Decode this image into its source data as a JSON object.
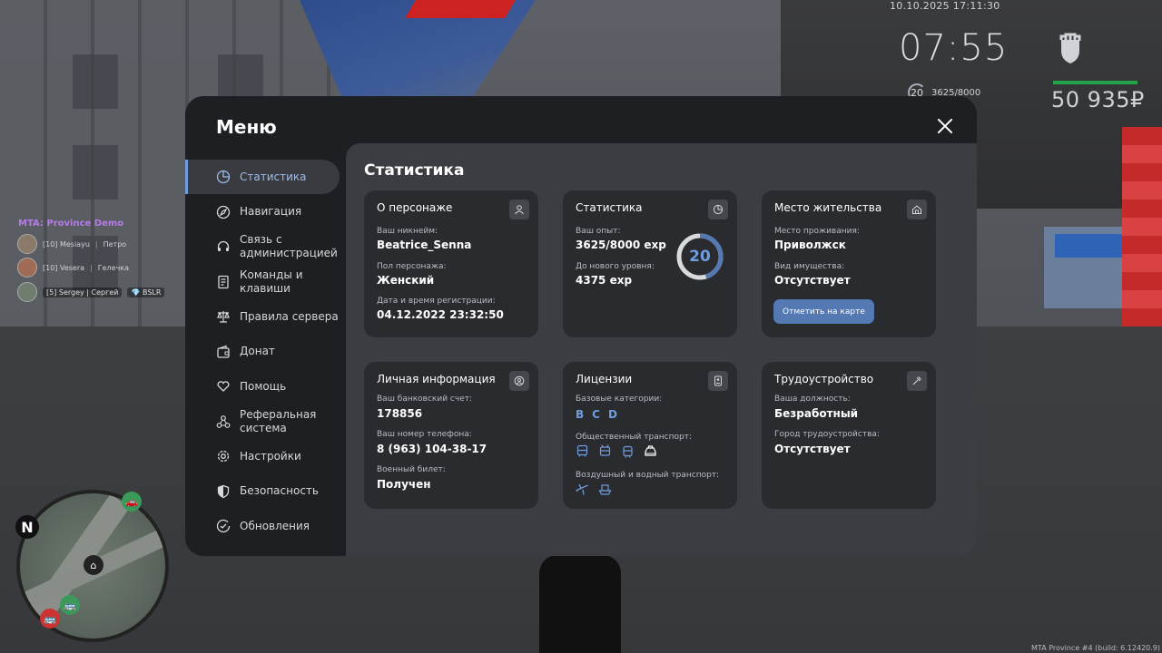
{
  "hud": {
    "datetime": "10.10.2025 17:11:30",
    "clock": "07:55",
    "level": "20",
    "exp": "3625/8000",
    "money": "50 935₽"
  },
  "server": {
    "name": "MTA: Province Demo",
    "players": [
      {
        "tag": "[10] Mesiayu",
        "name": "Петро"
      },
      {
        "tag": "[10] Vesera",
        "name": "Гелечка"
      },
      {
        "tag": "[5] Sergey",
        "name": "Сергей",
        "badge": "BSLR"
      }
    ],
    "build": "MTA Province #4 (build: 6.12420.9)"
  },
  "minimap": {
    "north": "N"
  },
  "menu": {
    "title": "Меню",
    "sidebar": [
      {
        "label": "Статистика",
        "icon": "pie-chart-icon"
      },
      {
        "label": "Навигация",
        "icon": "compass-icon"
      },
      {
        "label": "Связь с администрацией",
        "icon": "headset-icon"
      },
      {
        "label": "Команды и клавиши",
        "icon": "document-icon"
      },
      {
        "label": "Правила сервера",
        "icon": "scales-icon"
      },
      {
        "label": "Донат",
        "icon": "wallet-icon"
      },
      {
        "label": "Помощь",
        "icon": "heart-hands-icon"
      },
      {
        "label": "Реферальная система",
        "icon": "network-icon"
      },
      {
        "label": "Настройки",
        "icon": "gear-icon"
      },
      {
        "label": "Безопасность",
        "icon": "shield-icon"
      },
      {
        "label": "Обновления",
        "icon": "check-circle-icon"
      }
    ],
    "section_title": "Статистика",
    "cards": {
      "character": {
        "title": "О персонаже",
        "nick_label": "Ваш никнейм:",
        "nick": "Beatrice_Senna",
        "gender_label": "Пол персонажа:",
        "gender": "Женский",
        "reg_label": "Дата и время регистрации:",
        "reg": "04.12.2022 23:32:50"
      },
      "stats": {
        "title": "Статистика",
        "exp_label": "Ваш опыт:",
        "exp": "3625/8000 exp",
        "next_label": "До нового уровня:",
        "next": "4375 exp",
        "level": "20",
        "progress": 0.453
      },
      "residence": {
        "title": "Место жительства",
        "place_label": "Место проживания:",
        "place": "Приволжск",
        "property_label": "Вид имущества:",
        "property": "Отсутствует",
        "map_button": "Отметить на карте"
      },
      "personal": {
        "title": "Личная информация",
        "bank_label": "Ваш банковский счет:",
        "bank": "178856",
        "phone_label": "Ваш номер телефона:",
        "phone": "8 (963) 104-38-17",
        "military_label": "Военный билет:",
        "military": "Получен"
      },
      "licenses": {
        "title": "Лицензии",
        "base_label": "Базовые категории:",
        "categories": [
          "B",
          "C",
          "D"
        ],
        "public_label": "Общественный транспорт:",
        "air_label": "Воздушный и водный транспорт:"
      },
      "employment": {
        "title": "Трудоустройство",
        "position_label": "Ваша должность:",
        "position": "Безработный",
        "city_label": "Город трудоустройства:",
        "city": "Отсутствует"
      }
    }
  },
  "colors": {
    "accent": "#6f9ddf",
    "button": "#5479b3",
    "card": "#2a2b2f",
    "panel": "#3c3d42",
    "window": "#1e1f22"
  }
}
